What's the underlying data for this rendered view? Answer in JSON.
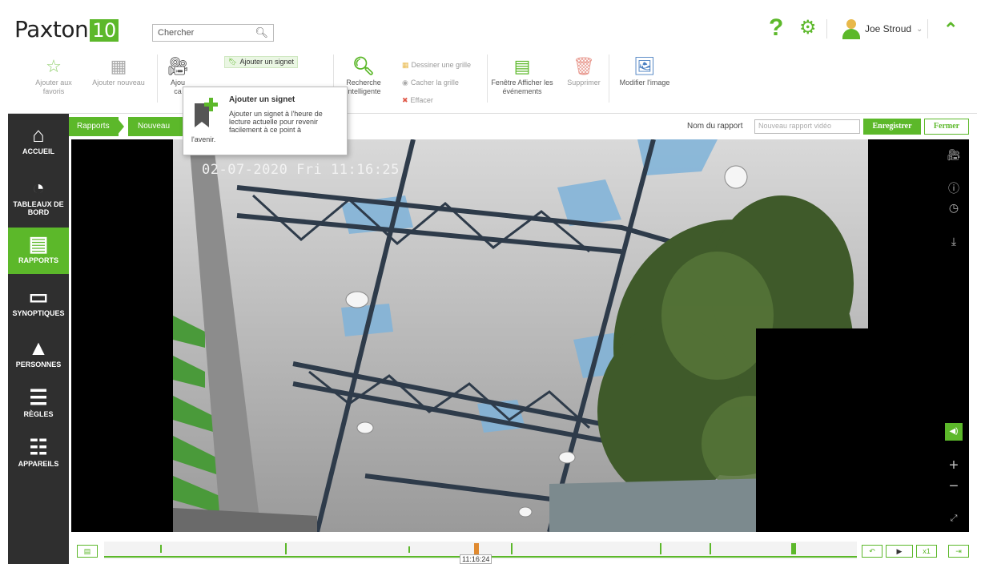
{
  "app": {
    "name": "Paxton",
    "version": "10"
  },
  "search": {
    "placeholder": "Chercher"
  },
  "user": {
    "name": "Joe Stroud"
  },
  "ribbon": {
    "add_favorites": "Ajouter aux favoris",
    "add_new": "Ajouter nouveau",
    "add_camera_partial": "Ajou",
    "add_camera_partial2": "ca",
    "add_bookmark": "Ajouter un signet",
    "smart_search": "Recherche intelligente",
    "draw_grid": "Dessiner une grille",
    "hide_grid": "Cacher la grille",
    "clear": "Effacer",
    "show_events_window": "Fenêtre Afficher les événements",
    "delete": "Supprimer",
    "edit_image": "Modifier l'image"
  },
  "tooltip": {
    "title": "Ajouter un signet",
    "description": "Ajouter un signet à l'heure de lecture actuelle pour revenir facilement à ce point à",
    "continuation": "l'avenir."
  },
  "nav": {
    "items": [
      {
        "label": "ACCUEIL",
        "icon": "home-icon"
      },
      {
        "label": "TABLEAUX DE BORD",
        "icon": "gauge-icon"
      },
      {
        "label": "RAPPORTS",
        "icon": "report-icon",
        "active": true
      },
      {
        "label": "SYNOPTIQUES",
        "icon": "floorplan-icon"
      },
      {
        "label": "PERSONNES",
        "icon": "person-icon"
      },
      {
        "label": "RÈGLES",
        "icon": "rules-icon"
      },
      {
        "label": "APPAREILS",
        "icon": "devices-icon"
      }
    ]
  },
  "breadcrumb": {
    "root": "Rapports",
    "current": "Nouveau rap"
  },
  "report": {
    "name_label": "Nom du rapport",
    "name_placeholder": "Nouveau rapport vidéo",
    "save": "Enregistrer",
    "close": "Fermer"
  },
  "video": {
    "timestamp": "02-07-2020 Fri 11:16:25"
  },
  "timeline": {
    "current_time": "11:16:24",
    "speed": "x1"
  },
  "colors": {
    "accent": "#5cb82a",
    "nav_bg": "#2f2f2f"
  }
}
